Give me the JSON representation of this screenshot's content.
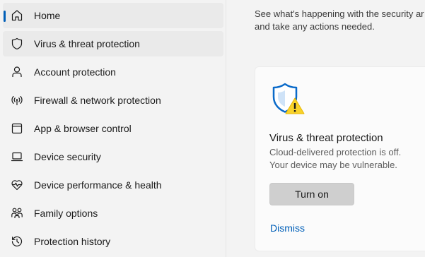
{
  "nav": {
    "items": [
      {
        "label": "Home",
        "icon": "home-icon",
        "state": "active"
      },
      {
        "label": "Virus & threat protection",
        "icon": "shield-icon",
        "state": "hover"
      },
      {
        "label": "Account protection",
        "icon": "person-icon",
        "state": ""
      },
      {
        "label": "Firewall & network protection",
        "icon": "wireless-icon",
        "state": ""
      },
      {
        "label": "App & browser control",
        "icon": "browser-window-icon",
        "state": ""
      },
      {
        "label": "Device security",
        "icon": "laptop-icon",
        "state": ""
      },
      {
        "label": "Device performance & health",
        "icon": "heart-pulse-icon",
        "state": ""
      },
      {
        "label": "Family options",
        "icon": "family-icon",
        "state": ""
      },
      {
        "label": "Protection history",
        "icon": "history-icon",
        "state": ""
      }
    ]
  },
  "main": {
    "intro": "See what's happening with the security ar\nand take any actions needed.",
    "card": {
      "icon": "shield-warning-icon",
      "title": "Virus & threat protection",
      "description": "Cloud-delivered protection is off.\nYour device may be vulnerable.",
      "button_label": "Turn on",
      "dismiss_label": "Dismiss"
    }
  },
  "colors": {
    "accent": "#005fb8",
    "warning": "#f8d22a",
    "shield_blue": "#0a6ac9"
  }
}
